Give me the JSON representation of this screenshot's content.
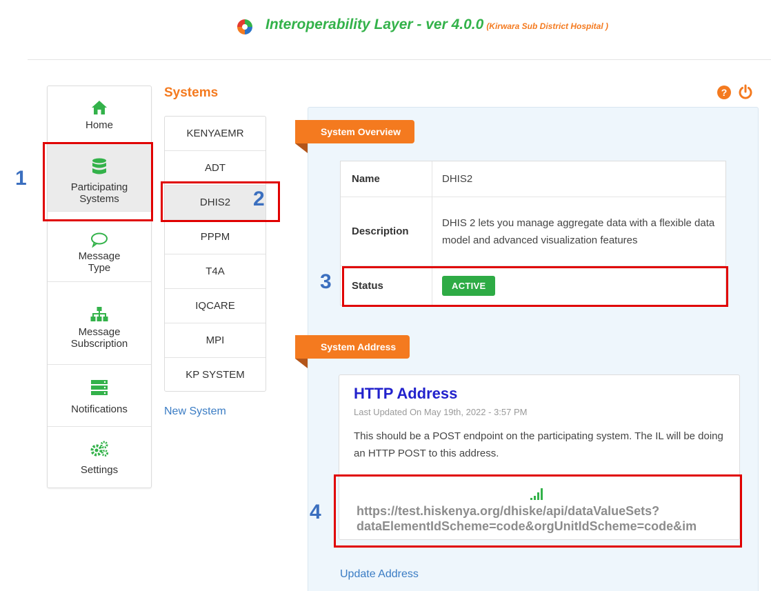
{
  "header": {
    "title": "Interoperability Layer - ver 4.0.0",
    "subtitle": "(Kirwara Sub District Hospital )"
  },
  "nav": {
    "items": [
      {
        "label1": "Home",
        "label2": "",
        "icon": "home-icon"
      },
      {
        "label1": "Participating",
        "label2": "Systems",
        "icon": "database-icon"
      },
      {
        "label1": "Message",
        "label2": "Type",
        "icon": "chat-bubble-icon"
      },
      {
        "label1": "Message",
        "label2": "Subscription",
        "icon": "sitemap-icon"
      },
      {
        "label1": "Notifications",
        "label2": "",
        "icon": "server-icon"
      },
      {
        "label1": "Settings",
        "label2": "",
        "icon": "gears-icon"
      }
    ]
  },
  "systems": {
    "heading": "Systems",
    "items": [
      "KENYAEMR",
      "ADT",
      "DHIS2",
      "PPPM",
      "T4A",
      "IQCARE",
      "MPI",
      "KP SYSTEM"
    ],
    "new_label": "New System"
  },
  "overview": {
    "ribbon": "System Overview",
    "name_label": "Name",
    "name_value": "DHIS2",
    "desc_label": "Description",
    "desc_value": "DHIS 2 lets you manage aggregate data with a flexible data model and advanced visualization features",
    "status_label": "Status",
    "status_value": "ACTIVE"
  },
  "address": {
    "ribbon": "System Address",
    "title": "HTTP Address",
    "updated": "Last Updated On May 19th, 2022 - 3:57 PM",
    "description": "This should be a POST endpoint on the participating system. The IL will be doing an HTTP POST to this address.",
    "url_line1": "https://test.hiskenya.org/dhiske/api/dataValueSets?",
    "url_line2": "dataElementIdScheme=code&orgUnitIdScheme=code&im",
    "update_label": "Update Address"
  },
  "annotations": [
    "1",
    "2",
    "3",
    "4"
  ],
  "colors": {
    "orange": "#f47a1f",
    "green": "#33b24a",
    "active_badge": "#2eab45",
    "link_blue": "#3a7cc4",
    "annotation_red": "#e00000",
    "annotation_number": "#3b6fbf"
  }
}
